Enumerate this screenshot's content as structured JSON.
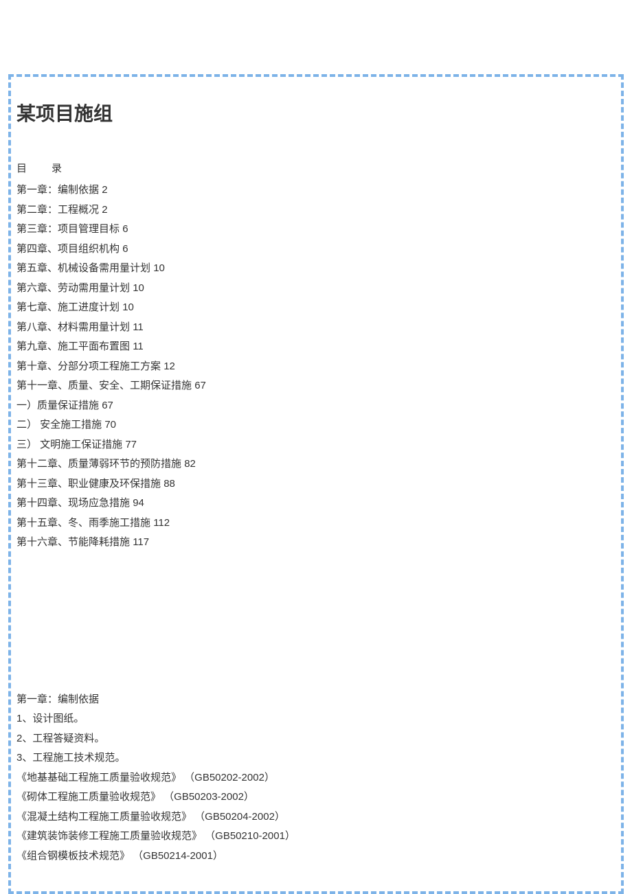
{
  "title": "某项目施组",
  "toc_header": "目　　录",
  "toc": [
    {
      "label": "第一章：编制依据",
      "page": "2"
    },
    {
      "label": "第二章：工程概况",
      "page": "2"
    },
    {
      "label": "第三章：项目管理目标",
      "page": "6"
    },
    {
      "label": "第四章、项目组织机构",
      "page": "6"
    },
    {
      "label": "第五章、机械设备需用量计划",
      "page": "10"
    },
    {
      "label": "第六章、劳动需用量计划",
      "page": "10"
    },
    {
      "label": "第七章、施工进度计划",
      "page": "10"
    },
    {
      "label": "第八章、材料需用量计划",
      "page": "11"
    },
    {
      "label": "第九章、施工平面布置图",
      "page": "11"
    },
    {
      "label": "第十章、分部分项工程施工方案",
      "page": "12"
    },
    {
      "label": "第十一章、质量、安全、工期保证措施",
      "page": "67"
    },
    {
      "label": "一）质量保证措施",
      "page": "67"
    },
    {
      "label": "二）  安全施工措施",
      "page": "70"
    },
    {
      "label": "三）  文明施工保证措施",
      "page": "77"
    },
    {
      "label": "第十二章、质量薄弱环节的预防措施",
      "page": "82"
    },
    {
      "label": "第十三章、职业健康及环保措施",
      "page": "88"
    },
    {
      "label": "第十四章、现场应急措施",
      "page": "94"
    },
    {
      "label": "第十五章、冬、雨季施工措施",
      "page": "112"
    },
    {
      "label": "第十六章、节能降耗措施",
      "page": "117"
    }
  ],
  "content": {
    "chapter_title": "第一章：编制依据",
    "lines": [
      "1、设计图纸。",
      "2、工程答疑资料。",
      "3、工程施工技术规范。",
      "《地基基础工程施工质量验收规范》  （GB50202-2002）",
      "《砌体工程施工质量验收规范》  （GB50203-2002）",
      "《混凝土结构工程施工质量验收规范》  （GB50204-2002）",
      "《建筑装饰装修工程施工质量验收规范》  （GB50210-2001）",
      "《组合钢模板技术规范》    （GB50214-2001）"
    ]
  }
}
